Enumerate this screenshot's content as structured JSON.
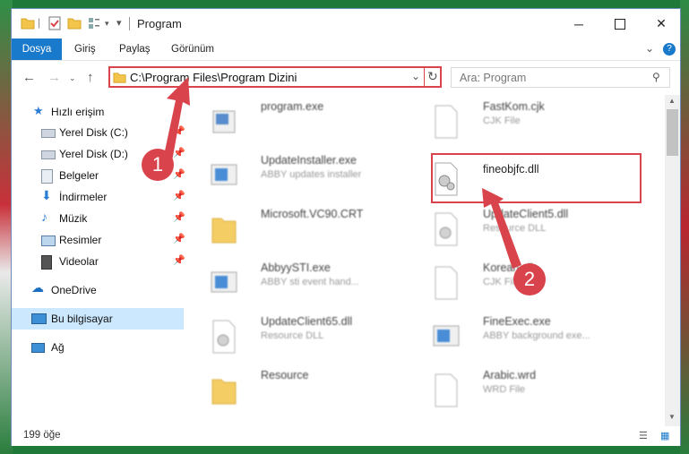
{
  "window": {
    "title": "Program"
  },
  "ribbon": {
    "tabs": [
      "Dosya",
      "Giriş",
      "Paylaş",
      "Görünüm"
    ]
  },
  "address": {
    "path": "C:\\Program Files\\Program Dizini"
  },
  "search": {
    "placeholder": "Ara: Program"
  },
  "sidebar": {
    "items": [
      {
        "label": "Hızlı erişim",
        "icon": "star-icon"
      },
      {
        "label": "Yerel Disk (C:)",
        "icon": "drive-icon"
      },
      {
        "label": "Yerel Disk (D:)",
        "icon": "drive-icon"
      },
      {
        "label": "Belgeler",
        "icon": "documents-icon"
      },
      {
        "label": "İndirmeler",
        "icon": "download-icon"
      },
      {
        "label": "Müzik",
        "icon": "music-icon"
      },
      {
        "label": "Resimler",
        "icon": "pictures-icon"
      },
      {
        "label": "Videolar",
        "icon": "videos-icon"
      },
      {
        "label": "OneDrive",
        "icon": "cloud-icon"
      },
      {
        "label": "Bu bilgisayar",
        "icon": "computer-icon"
      },
      {
        "label": "Ağ",
        "icon": "network-icon"
      }
    ]
  },
  "files": [
    {
      "name": "program.exe",
      "desc": ""
    },
    {
      "name": "FastKom.cjk",
      "desc": "CJK File"
    },
    {
      "name": "UpdateInstaller.exe",
      "desc": "ABBY updates installer"
    },
    {
      "name": "fineobjfc.dll",
      "desc": ""
    },
    {
      "name": "Microsoft.VC90.CRT",
      "desc": ""
    },
    {
      "name": "UpdateClient5.dll",
      "desc": "Resource DLL"
    },
    {
      "name": "AbbyySTI.exe",
      "desc": "ABBY sti event hand..."
    },
    {
      "name": "Korean.cjk",
      "desc": "CJK File"
    },
    {
      "name": "UpdateClient65.dll",
      "desc": "Resource DLL"
    },
    {
      "name": "FineExec.exe",
      "desc": "ABBY background exe..."
    },
    {
      "name": "Resource",
      "desc": ""
    },
    {
      "name": "Arabic.wrd",
      "desc": "WRD File"
    }
  ],
  "status": {
    "count": "199 öğe"
  },
  "annotations": {
    "step1": "1",
    "step2": "2"
  },
  "colors": {
    "accent": "#1979ca",
    "highlight": "#d9434c",
    "selection": "#cce8ff"
  }
}
